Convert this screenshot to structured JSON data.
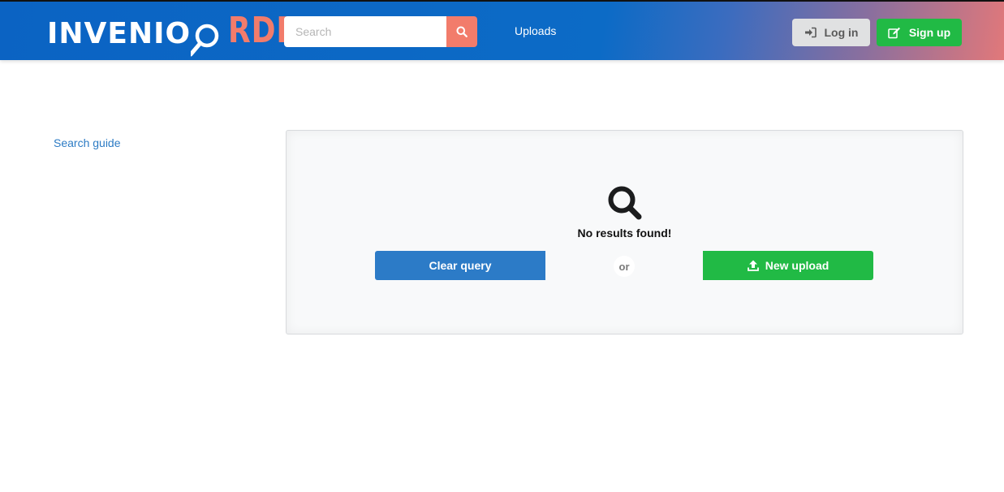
{
  "header": {
    "logo": {
      "part1": "INVENIO",
      "part2": "RDM"
    },
    "search": {
      "placeholder": "Search",
      "value": ""
    },
    "nav": {
      "uploads_label": "Uploads"
    },
    "auth": {
      "login_label": "Log in",
      "signup_label": "Sign up"
    }
  },
  "sidebar": {
    "search_guide_label": "Search guide"
  },
  "results": {
    "empty_message": "No results found!",
    "clear_query_label": "Clear query",
    "or_label": "or",
    "new_upload_label": "New upload"
  },
  "icons": {
    "search_button": "search-icon",
    "login": "sign-in-icon",
    "signup": "edit-icon",
    "empty_state": "search-icon",
    "new_upload": "upload-icon"
  },
  "colors": {
    "header_blue": "#0c6bc6",
    "brand_salmon": "#f27c6b",
    "primary_blue": "#2c7bc7",
    "success_green": "#21ba45",
    "login_gray": "#e0e1e2",
    "link_blue": "#2c7bc4"
  }
}
